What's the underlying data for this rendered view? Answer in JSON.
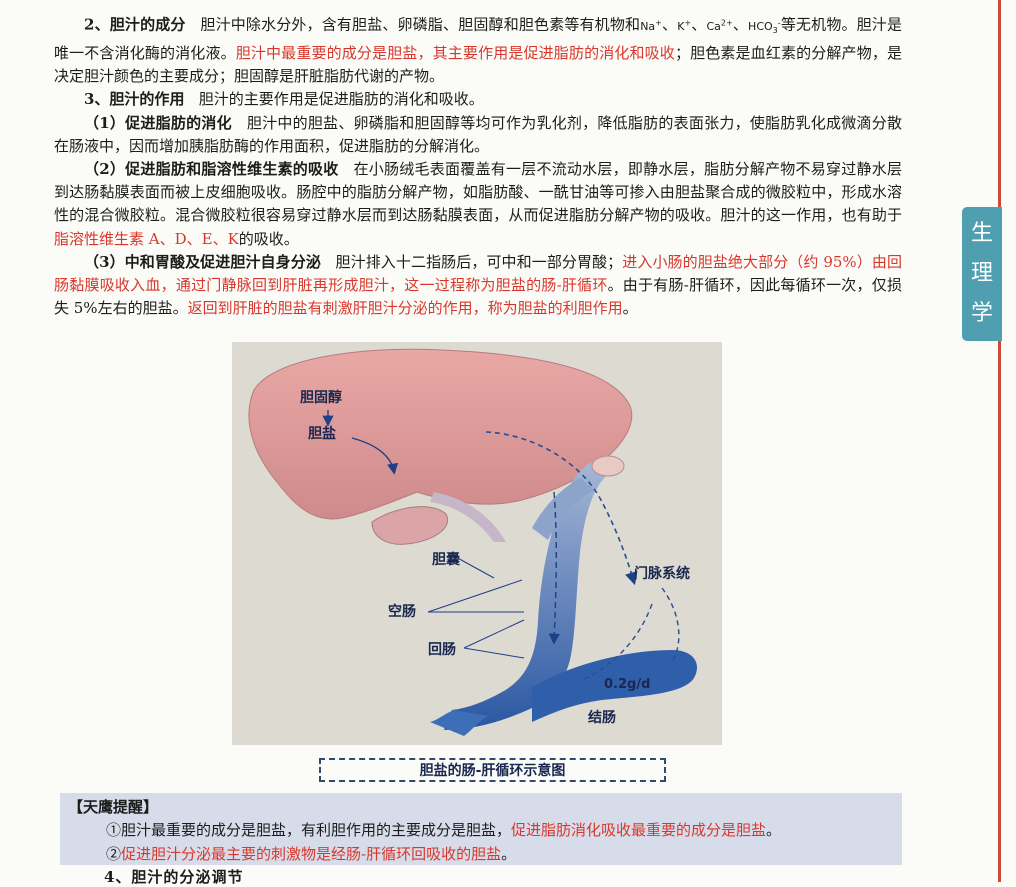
{
  "tab": {
    "chars": [
      "生",
      "理",
      "学"
    ]
  },
  "sec2": {
    "heading": "2、胆汁的成分",
    "text1": "胆汁中除水分外，含有胆盐、卵磷脂、胆固醇和胆色素等有机物和",
    "ion_na": "Na",
    "ion_na_sup": "+",
    "ion_k": "K",
    "ion_k_sup": "+",
    "ion_ca": "Ca",
    "ion_ca_sup": "2+",
    "ion_hco": "HCO",
    "ion_hco_sub": "3",
    "ion_hco_sup": "-",
    "sep": "、",
    "text2": "等无机物。胆汁是唯一不含消化酶的消化液。",
    "red1": "胆汁中最重要的成分是胆盐，其主要作用是促进脂肪的消化和吸收",
    "text3": "；胆色素是血红素的分解产物，是决定胆汁颜色的主要成分；胆固醇是肝脏脂肪代谢的产物。"
  },
  "sec3": {
    "heading": "3、胆汁的作用",
    "text": "胆汁的主要作用是促进脂肪的消化和吸收。",
    "p1_heading": "（1）促进脂肪的消化",
    "p1_text": "胆汁中的胆盐、卵磷脂和胆固醇等均可作为乳化剂，降低脂肪的表面张力，使脂肪乳化成微滴分散在肠液中，因而增加胰脂肪酶的作用面积，促进脂肪的分解消化。",
    "p2_heading": "（2）促进脂肪和脂溶性维生素的吸收",
    "p2_text1": "在小肠绒毛表面覆盖有一层不流动水层，即静水层，脂肪分解产物不易穿过静水层到达肠黏膜表面而被上皮细胞吸收。肠腔中的脂肪分解产物，如脂肪酸、一酰甘油等可掺入由胆盐聚合成的微胶粒中，形成水溶性的混合微胶粒。混合微胶粒很容易穿过静水层而到达肠黏膜表面，从而促进脂肪分解产物的吸收。胆汁的这一作用，也有助于",
    "p2_red": "脂溶性维生素 A、D、E、K",
    "p2_text2": "的吸收。",
    "p3_heading": "（3）中和胃酸及促进胆汁自身分泌",
    "p3_text1": "胆汁排入十二指肠后，可中和一部分胃酸；",
    "p3_red1": "进入小肠的胆盐绝大部分（约 95%）由回肠黏膜吸收入血，通过门静脉回到肝脏再形成胆汁，这一过程称为胆盐的肠-肝循环",
    "p3_text2": "。由于有肠-肝循环，因此每循环一次，仅损失 5%左右的胆盐。",
    "p3_red2": "返回到肝脏的胆盐有刺激肝胆汁分泌的作用，称为胆盐的利胆作用",
    "p3_end": "。"
  },
  "figure": {
    "labels": {
      "cholesterol": "胆固醇",
      "bile_salt": "胆盐",
      "gallbladder": "胆囊",
      "portal": "门脉系统",
      "jejunum": "空肠",
      "ileum": "回肠",
      "rate": "0.2g/d",
      "colon": "结肠"
    },
    "caption": "胆盐的肠-肝循环示意图"
  },
  "tip": {
    "title": "【天鹰提醒】",
    "line1_text": "①胆汁最重要的成分是胆盐，有利胆作用的主要成分是胆盐，",
    "line1_red": "促进脂肪消化吸收最重要的成分是胆盐",
    "line1_end": "。",
    "line2_num": "②",
    "line2_red": "促进胆汁分泌最主要的刺激物是经肠-肝循环回吸收的胆盐",
    "line2_end": "。"
  },
  "next_heading": "4、胆汁的分泌调节",
  "colors": {
    "accent_red": "#d8382c",
    "tab_teal": "#4f9fb0",
    "tip_bg": "#d7dcea",
    "liver": "#d98e8e",
    "intestine": "#2e5fa8"
  }
}
